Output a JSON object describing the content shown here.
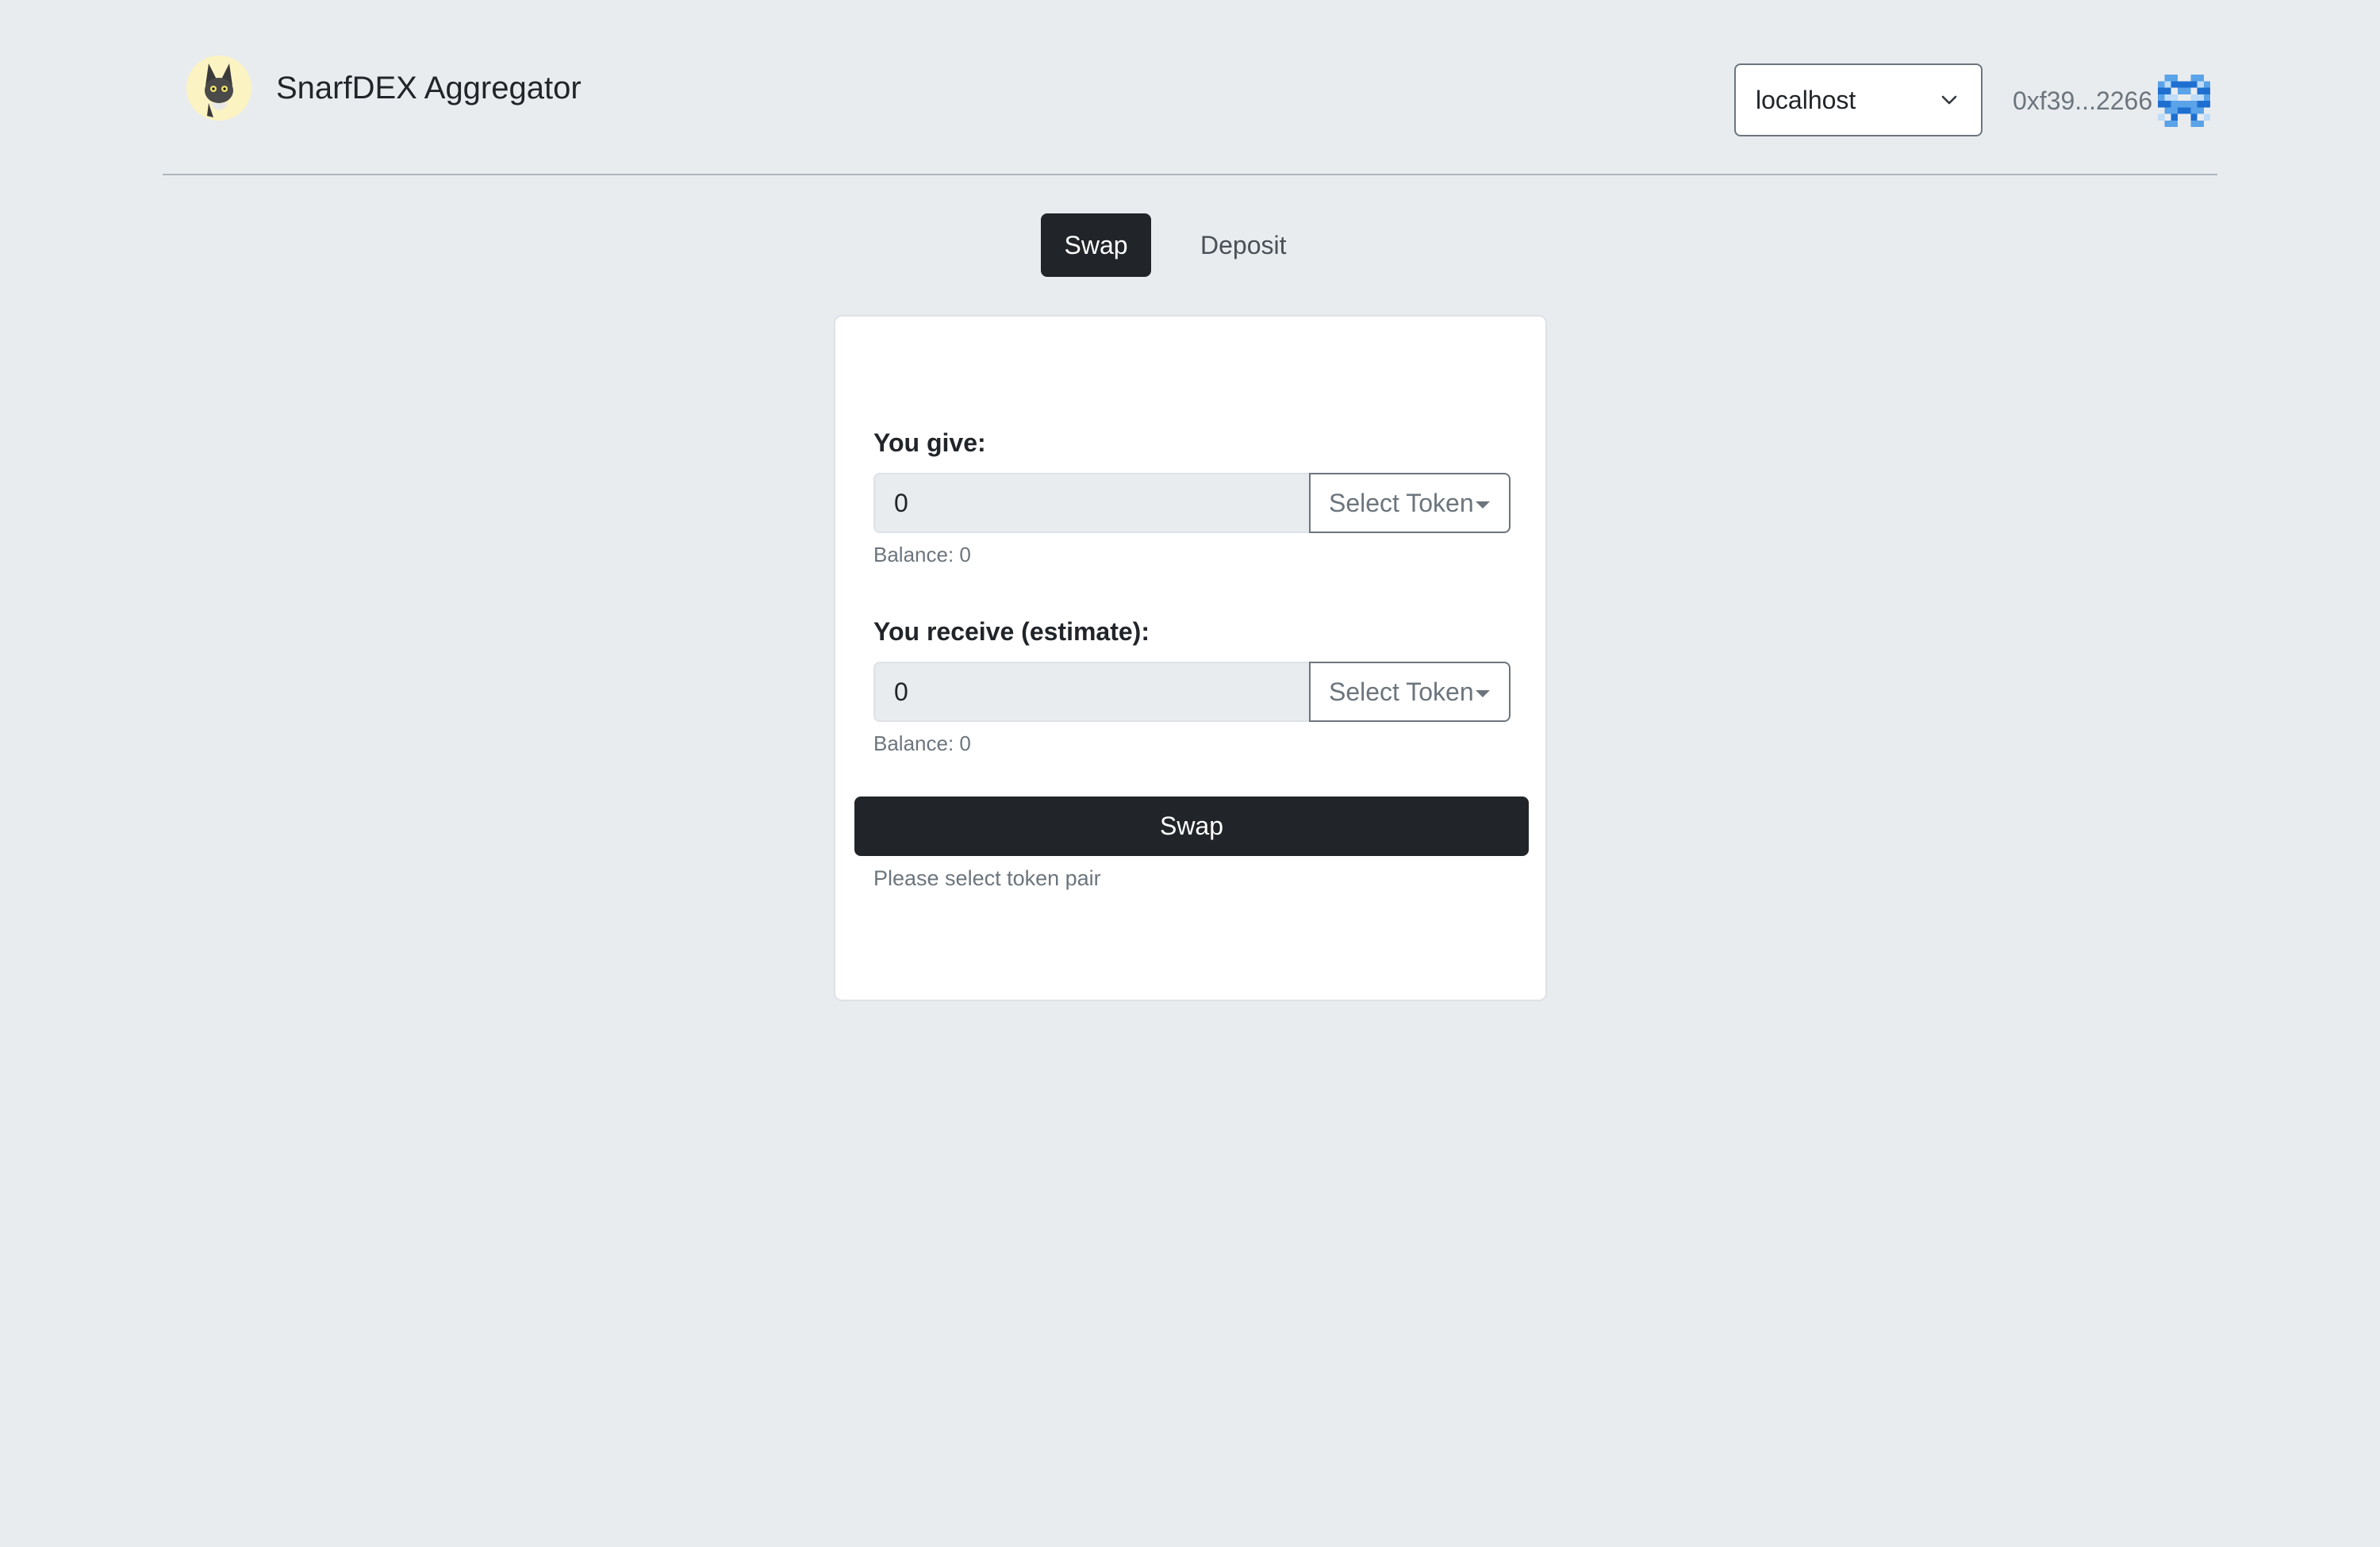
{
  "header": {
    "app_title": "SnarfDEX Aggregator",
    "network": "localhost",
    "address": "0xf39...2266"
  },
  "tabs": [
    {
      "label": "Swap",
      "active": true
    },
    {
      "label": "Deposit",
      "active": false
    }
  ],
  "swap_form": {
    "give": {
      "label": "You give:",
      "amount": "0",
      "token_button": "Select Token",
      "balance": "Balance: 0"
    },
    "receive": {
      "label": "You receive (estimate):",
      "amount": "0",
      "token_button": "Select Token",
      "balance": "Balance: 0"
    },
    "submit_label": "Swap",
    "status": "Please select token pair"
  },
  "colors": {
    "background": "#e9ecef",
    "primary_dark": "#212529",
    "muted": "#6c757d"
  },
  "icons": {
    "logo": "snarf-cat-logo",
    "network_chevron": "chevron-down-icon",
    "identicon": "identicon"
  }
}
